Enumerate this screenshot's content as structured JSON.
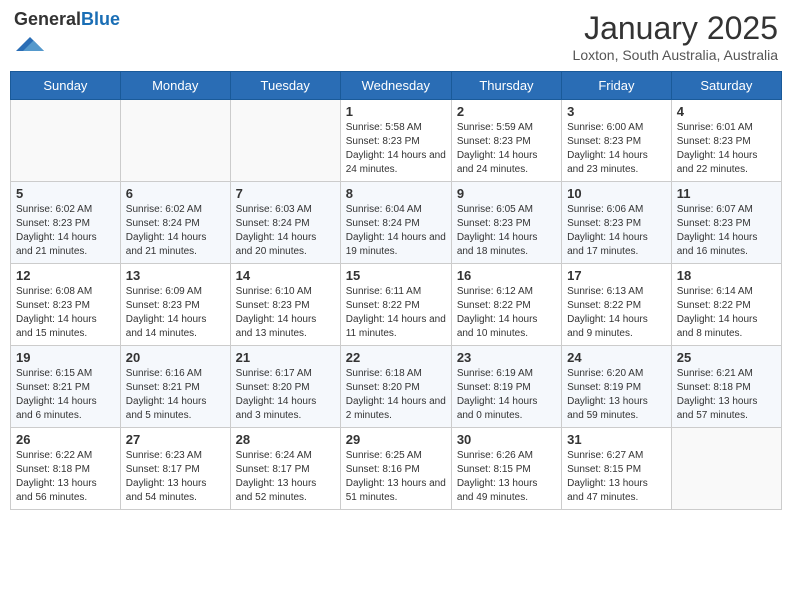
{
  "header": {
    "logo_text_general": "General",
    "logo_text_blue": "Blue",
    "month": "January 2025",
    "location": "Loxton, South Australia, Australia"
  },
  "days_of_week": [
    "Sunday",
    "Monday",
    "Tuesday",
    "Wednesday",
    "Thursday",
    "Friday",
    "Saturday"
  ],
  "weeks": [
    [
      {
        "day": "",
        "info": ""
      },
      {
        "day": "",
        "info": ""
      },
      {
        "day": "",
        "info": ""
      },
      {
        "day": "1",
        "info": "Sunrise: 5:58 AM\nSunset: 8:23 PM\nDaylight: 14 hours and 24 minutes."
      },
      {
        "day": "2",
        "info": "Sunrise: 5:59 AM\nSunset: 8:23 PM\nDaylight: 14 hours and 24 minutes."
      },
      {
        "day": "3",
        "info": "Sunrise: 6:00 AM\nSunset: 8:23 PM\nDaylight: 14 hours and 23 minutes."
      },
      {
        "day": "4",
        "info": "Sunrise: 6:01 AM\nSunset: 8:23 PM\nDaylight: 14 hours and 22 minutes."
      }
    ],
    [
      {
        "day": "5",
        "info": "Sunrise: 6:02 AM\nSunset: 8:23 PM\nDaylight: 14 hours and 21 minutes."
      },
      {
        "day": "6",
        "info": "Sunrise: 6:02 AM\nSunset: 8:24 PM\nDaylight: 14 hours and 21 minutes."
      },
      {
        "day": "7",
        "info": "Sunrise: 6:03 AM\nSunset: 8:24 PM\nDaylight: 14 hours and 20 minutes."
      },
      {
        "day": "8",
        "info": "Sunrise: 6:04 AM\nSunset: 8:24 PM\nDaylight: 14 hours and 19 minutes."
      },
      {
        "day": "9",
        "info": "Sunrise: 6:05 AM\nSunset: 8:23 PM\nDaylight: 14 hours and 18 minutes."
      },
      {
        "day": "10",
        "info": "Sunrise: 6:06 AM\nSunset: 8:23 PM\nDaylight: 14 hours and 17 minutes."
      },
      {
        "day": "11",
        "info": "Sunrise: 6:07 AM\nSunset: 8:23 PM\nDaylight: 14 hours and 16 minutes."
      }
    ],
    [
      {
        "day": "12",
        "info": "Sunrise: 6:08 AM\nSunset: 8:23 PM\nDaylight: 14 hours and 15 minutes."
      },
      {
        "day": "13",
        "info": "Sunrise: 6:09 AM\nSunset: 8:23 PM\nDaylight: 14 hours and 14 minutes."
      },
      {
        "day": "14",
        "info": "Sunrise: 6:10 AM\nSunset: 8:23 PM\nDaylight: 14 hours and 13 minutes."
      },
      {
        "day": "15",
        "info": "Sunrise: 6:11 AM\nSunset: 8:22 PM\nDaylight: 14 hours and 11 minutes."
      },
      {
        "day": "16",
        "info": "Sunrise: 6:12 AM\nSunset: 8:22 PM\nDaylight: 14 hours and 10 minutes."
      },
      {
        "day": "17",
        "info": "Sunrise: 6:13 AM\nSunset: 8:22 PM\nDaylight: 14 hours and 9 minutes."
      },
      {
        "day": "18",
        "info": "Sunrise: 6:14 AM\nSunset: 8:22 PM\nDaylight: 14 hours and 8 minutes."
      }
    ],
    [
      {
        "day": "19",
        "info": "Sunrise: 6:15 AM\nSunset: 8:21 PM\nDaylight: 14 hours and 6 minutes."
      },
      {
        "day": "20",
        "info": "Sunrise: 6:16 AM\nSunset: 8:21 PM\nDaylight: 14 hours and 5 minutes."
      },
      {
        "day": "21",
        "info": "Sunrise: 6:17 AM\nSunset: 8:20 PM\nDaylight: 14 hours and 3 minutes."
      },
      {
        "day": "22",
        "info": "Sunrise: 6:18 AM\nSunset: 8:20 PM\nDaylight: 14 hours and 2 minutes."
      },
      {
        "day": "23",
        "info": "Sunrise: 6:19 AM\nSunset: 8:19 PM\nDaylight: 14 hours and 0 minutes."
      },
      {
        "day": "24",
        "info": "Sunrise: 6:20 AM\nSunset: 8:19 PM\nDaylight: 13 hours and 59 minutes."
      },
      {
        "day": "25",
        "info": "Sunrise: 6:21 AM\nSunset: 8:18 PM\nDaylight: 13 hours and 57 minutes."
      }
    ],
    [
      {
        "day": "26",
        "info": "Sunrise: 6:22 AM\nSunset: 8:18 PM\nDaylight: 13 hours and 56 minutes."
      },
      {
        "day": "27",
        "info": "Sunrise: 6:23 AM\nSunset: 8:17 PM\nDaylight: 13 hours and 54 minutes."
      },
      {
        "day": "28",
        "info": "Sunrise: 6:24 AM\nSunset: 8:17 PM\nDaylight: 13 hours and 52 minutes."
      },
      {
        "day": "29",
        "info": "Sunrise: 6:25 AM\nSunset: 8:16 PM\nDaylight: 13 hours and 51 minutes."
      },
      {
        "day": "30",
        "info": "Sunrise: 6:26 AM\nSunset: 8:15 PM\nDaylight: 13 hours and 49 minutes."
      },
      {
        "day": "31",
        "info": "Sunrise: 6:27 AM\nSunset: 8:15 PM\nDaylight: 13 hours and 47 minutes."
      },
      {
        "day": "",
        "info": ""
      }
    ]
  ]
}
